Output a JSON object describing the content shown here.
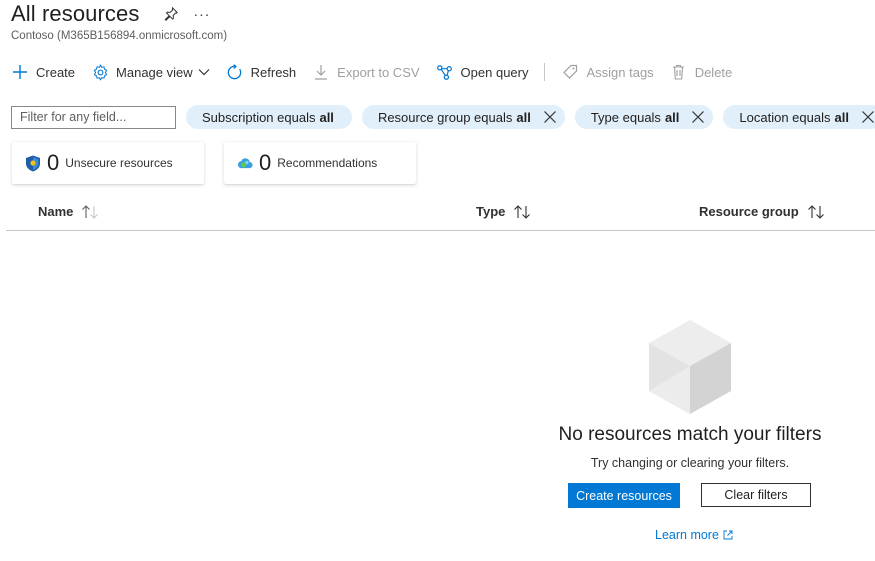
{
  "header": {
    "title": "All resources",
    "subtitle": "Contoso (M365B156894.onmicrosoft.com)",
    "more": "···"
  },
  "toolbar": {
    "create": "Create",
    "manage_view": "Manage view",
    "refresh": "Refresh",
    "export_csv": "Export to CSV",
    "open_query": "Open query",
    "assign_tags": "Assign tags",
    "delete": "Delete"
  },
  "filters": {
    "placeholder": "Filter for any field...",
    "pills": [
      {
        "label": "Subscription equals",
        "value": "all"
      },
      {
        "label": "Resource group equals",
        "value": "all"
      },
      {
        "label": "Type equals",
        "value": "all"
      },
      {
        "label": "Location equals",
        "value": "all"
      }
    ]
  },
  "cards": [
    {
      "count": "0",
      "label": "Unsecure resources",
      "icon": "shield-icon"
    },
    {
      "count": "0",
      "label": "Recommendations",
      "icon": "advisor-cloud-icon"
    }
  ],
  "table": {
    "columns": [
      "Name",
      "Type",
      "Resource group"
    ]
  },
  "empty_state": {
    "title": "No resources match your filters",
    "subtitle": "Try changing or clearing your filters.",
    "primary_button": "Create resources",
    "secondary_button": "Clear filters",
    "link": "Learn more"
  },
  "colors": {
    "accent": "#0078d4",
    "pill_bg": "#e1effa",
    "disabled_text": "#a19f9d"
  }
}
